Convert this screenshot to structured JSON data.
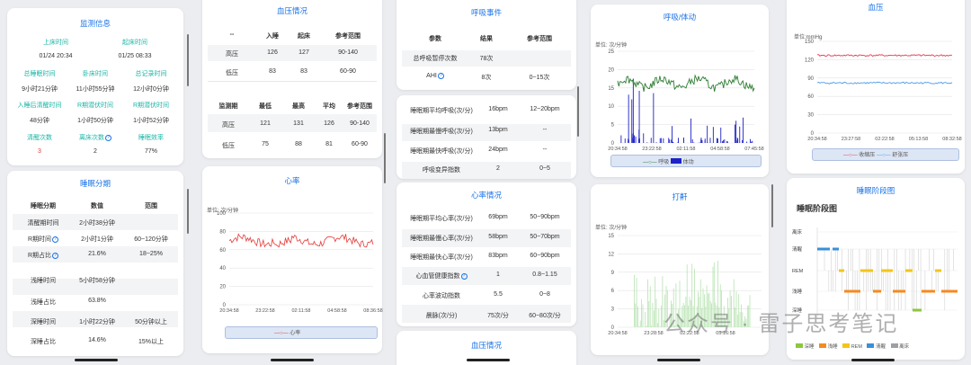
{
  "monitor": {
    "title": "监测信息",
    "h1": [
      "上床时间",
      "起床时间"
    ],
    "v1": [
      "01/24 20:34",
      "01/25 08:33"
    ],
    "h2": [
      "总睡眠时间",
      "卧床时间",
      "总记录时间"
    ],
    "v2": [
      "9小时21分钟",
      "11小时55分钟",
      "12小时0分钟"
    ],
    "h3": [
      "入睡后清醒时间",
      "R期潜伏时间",
      "R期潜伏时间"
    ],
    "v3": [
      "48分钟",
      "1小时50分钟",
      "1小时52分钟"
    ],
    "h4": [
      "清醒次数",
      "离床次数",
      "睡眠效率"
    ],
    "v4": [
      "3",
      "2",
      "77%"
    ]
  },
  "stage": {
    "title": "睡眠分期",
    "head": [
      "睡眠分期",
      "数值",
      "范围"
    ],
    "rows": [
      [
        "清醒期时间",
        "2小时38分钟",
        ""
      ],
      [
        "R期时间",
        "2小时1分钟",
        "60~120分钟"
      ],
      [
        "R期占比",
        "21.6%",
        "18~25%"
      ],
      [
        "浅睡时间",
        "5小时58分钟",
        ""
      ],
      [
        "浅睡占比",
        "63.8%",
        ""
      ],
      [
        "深睡时间",
        "1小时22分钟",
        "50分钟以上"
      ],
      [
        "深睡占比",
        "14.6%",
        "15%以上"
      ]
    ]
  },
  "bp": {
    "title": "血压情况",
    "head1": [
      "--",
      "入睡",
      "起床",
      "参考范围"
    ],
    "rows1": [
      [
        "高压",
        "126",
        "127",
        "90-140"
      ],
      [
        "低压",
        "83",
        "83",
        "60-90"
      ]
    ],
    "head2": [
      "监测期",
      "最低",
      "最高",
      "平均",
      "参考范围"
    ],
    "rows2": [
      [
        "高压",
        "121",
        "131",
        "126",
        "90-140"
      ],
      [
        "低压",
        "75",
        "88",
        "81",
        "60-90"
      ]
    ]
  },
  "hr_chart": {
    "title": "心率",
    "unit": "单位: 次/分钟",
    "legend": "心率"
  },
  "resp": {
    "title": "呼吸事件",
    "head": [
      "参数",
      "结果",
      "参考范围"
    ],
    "rows": [
      [
        "总呼吸暂停次数",
        "78次",
        ""
      ],
      [
        "AHI",
        "8次",
        "0~15次"
      ]
    ]
  },
  "breath": {
    "rows": [
      [
        "睡眠期平均呼吸(次/分)",
        "16bpm",
        "12~20bpm"
      ],
      [
        "睡眠期最慢呼吸(次/分)",
        "13bpm",
        "--"
      ],
      [
        "睡眠期最快呼吸(次/分)",
        "24bpm",
        "--"
      ],
      [
        "呼吸变异指数",
        "2",
        "0~5"
      ]
    ]
  },
  "hr": {
    "title": "心率情况",
    "rows": [
      [
        "睡眠期平均心率(次/分)",
        "69bpm",
        "50~90bpm"
      ],
      [
        "睡眠期最慢心率(次/分)",
        "58bpm",
        "50~70bpm"
      ],
      [
        "睡眠期最快心率(次/分)",
        "83bpm",
        "60~90bpm"
      ],
      [
        "心血管健康指数",
        "1",
        "0.8~1.15"
      ],
      [
        "心率波动指数",
        "5.5",
        "0~8"
      ],
      [
        "晨脉(次/分)",
        "75次/分",
        "60~80次/分"
      ]
    ]
  },
  "bp2_title": "血压情况",
  "breath_chart": {
    "title": "呼吸/体动",
    "unit": "单位: 次/分钟",
    "legend": [
      "呼吸",
      "体动"
    ]
  },
  "snore": {
    "title": "打鼾",
    "unit": "单位: 次/分钟"
  },
  "bp_chart": {
    "title": "血压",
    "unit": "单位:mmHg",
    "legend": [
      "收缩压",
      "舒张压"
    ]
  },
  "hyp": {
    "title": "睡眠阶段图",
    "heading": "睡眠阶段图",
    "levels": [
      "离床",
      "清醒",
      "REM",
      "浅睡",
      "深睡"
    ],
    "legend": [
      "深睡",
      "浅睡",
      "REM",
      "清醒",
      "离床"
    ]
  },
  "watermark": "公众号 · 雷子思考笔记",
  "chart_data": [
    {
      "type": "line",
      "title": "心率",
      "ylabel": "单位: 次/分钟",
      "ylim": [
        0,
        100
      ],
      "yticks": [
        0,
        20,
        40,
        60,
        80,
        100
      ],
      "xticks": [
        "20:34:58",
        "23:22:58",
        "02:11:58",
        "04:58:58",
        "08:36:58"
      ],
      "series": [
        {
          "name": "心率",
          "approx_range": [
            63,
            80
          ]
        }
      ]
    },
    {
      "type": "line",
      "title": "呼吸/体动",
      "ylabel": "单位: 次/分钟",
      "ylim": [
        0,
        25
      ],
      "yticks": [
        0,
        5,
        10,
        15,
        20,
        25
      ],
      "xticks": [
        "20:34:58",
        "23:22:58",
        "02:11:58",
        "04:58:58",
        "07:45:58"
      ],
      "series": [
        {
          "name": "呼吸",
          "approx_range": [
            14,
            19
          ]
        },
        {
          "name": "体动",
          "type": "bar"
        }
      ]
    },
    {
      "type": "bar",
      "title": "打鼾",
      "ylabel": "单位: 次/分钟",
      "ylim": [
        0,
        15
      ],
      "yticks": [
        0,
        3,
        6,
        9,
        12,
        15
      ],
      "xticks": [
        "20:34:58",
        "23:28:58",
        "02:22:58",
        "05:16:58"
      ]
    },
    {
      "type": "line",
      "title": "血压",
      "ylabel": "单位:mmHg",
      "ylim": [
        0,
        150
      ],
      "yticks": [
        0,
        30,
        60,
        90,
        120,
        150
      ],
      "xticks": [
        "20:34:58",
        "23:27:58",
        "02:22:58",
        "05:13:58",
        "08:32:58"
      ],
      "series": [
        {
          "name": "收缩压",
          "approx": 127
        },
        {
          "name": "舒张压",
          "approx": 82
        }
      ]
    }
  ]
}
